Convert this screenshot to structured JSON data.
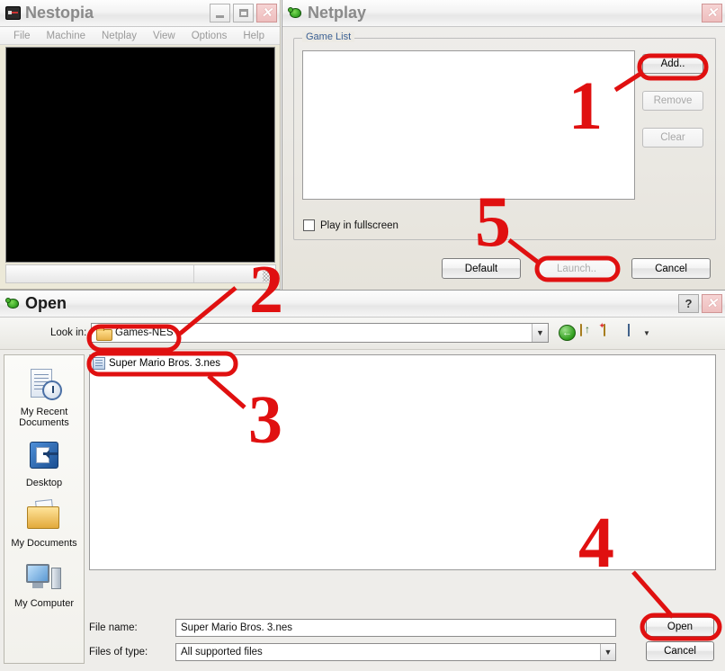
{
  "nestopia": {
    "title": "Nestopia",
    "icon": "nes-controller-icon",
    "menu": [
      "File",
      "Machine",
      "Netplay",
      "View",
      "Options",
      "Help"
    ],
    "window_buttons": {
      "minimize": "_",
      "maximize": "□",
      "close": "✕"
    }
  },
  "netplay": {
    "title": "Netplay",
    "icon": "turtle-icon",
    "close_button": "✕",
    "group_label": "Game List",
    "list_items": [],
    "fullscreen_label": "Play in fullscreen",
    "fullscreen_checked": false,
    "side_buttons": [
      {
        "label": "Add..",
        "enabled": true
      },
      {
        "label": "Remove",
        "enabled": false
      },
      {
        "label": "Clear",
        "enabled": false
      }
    ],
    "bottom_buttons": [
      {
        "label": "Default",
        "enabled": true
      },
      {
        "label": "Launch..",
        "enabled": false
      },
      {
        "label": "Cancel",
        "enabled": true
      }
    ]
  },
  "open_dialog": {
    "title": "Open",
    "icon": "turtle-icon",
    "help_button": "?",
    "close_button": "✕",
    "lookin_label": "Look in:",
    "lookin_value": "Games-NES",
    "lookin_caret": "▼",
    "toolbar": [
      {
        "name": "back-icon",
        "glyph": "←"
      },
      {
        "name": "up-one-level-icon",
        "glyph": ""
      },
      {
        "name": "new-folder-icon",
        "glyph": ""
      },
      {
        "name": "views-icon",
        "glyph": ""
      }
    ],
    "views_caret": "▼",
    "places": [
      {
        "label": "My Recent\nDocuments",
        "icon": "recent-documents-icon"
      },
      {
        "label": "Desktop",
        "icon": "desktop-icon"
      },
      {
        "label": "My Documents",
        "icon": "my-documents-icon"
      },
      {
        "label": "My Computer",
        "icon": "my-computer-icon"
      }
    ],
    "files": [
      {
        "name": "Super Mario Bros. 3.nes",
        "icon": "nes-rom-file-icon"
      }
    ],
    "filename_label": "File name:",
    "filename_value": "Super Mario Bros. 3.nes",
    "filetype_label": "Files of type:",
    "filetype_value": "All supported files",
    "filetype_caret": "▼",
    "open_button": "Open",
    "cancel_button": "Cancel"
  },
  "annotations": {
    "color": "#e01010",
    "steps": [
      {
        "label": "1",
        "points_to": "Add.. button"
      },
      {
        "label": "2",
        "points_to": "Look in: Games-NES"
      },
      {
        "label": "3",
        "points_to": "Super Mario Bros. 3.nes file"
      },
      {
        "label": "4",
        "points_to": "Open button"
      },
      {
        "label": "5",
        "points_to": "Launch.. button"
      }
    ]
  }
}
